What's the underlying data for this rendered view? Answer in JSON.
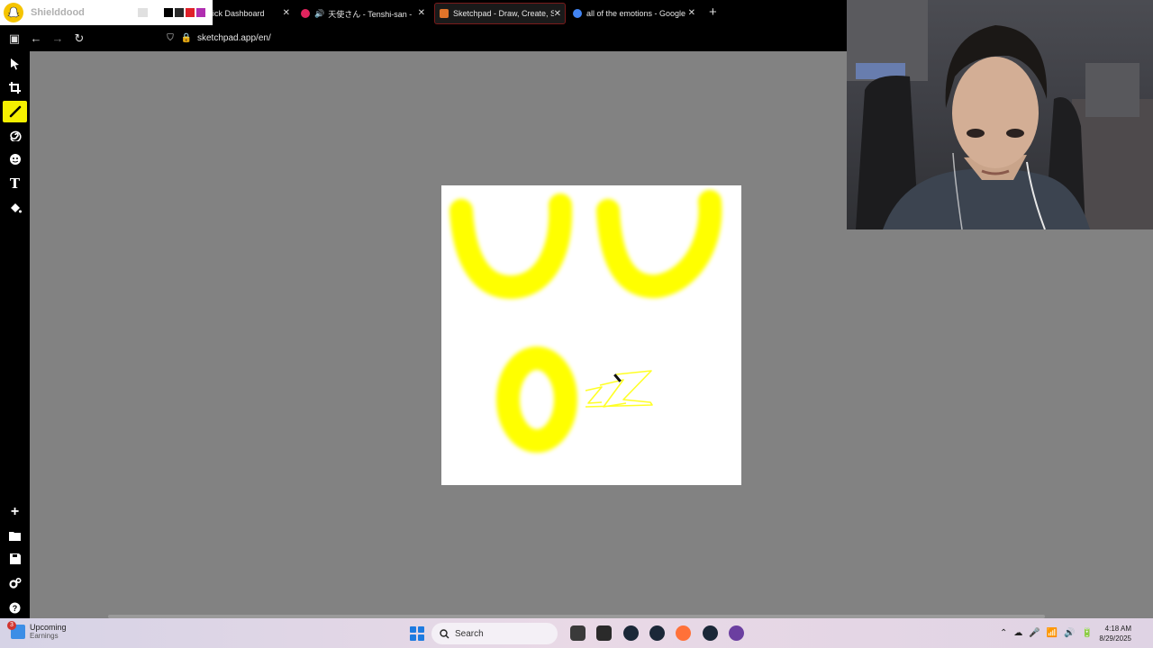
{
  "overlay": {
    "app_name": "Shielddood",
    "swatch_colors": [
      "#000000",
      "#2a2a2a",
      "#e0202a",
      "#b02eb0"
    ]
  },
  "tabs": [
    {
      "title": "ick Dashboard",
      "favicon_color": ""
    },
    {
      "title": "天使さん - Tenshi-san - You",
      "favicon_color": "#e0245e",
      "audio": true
    },
    {
      "title": "Sketchpad - Draw, Create, Shar",
      "favicon_color": "#e0742a",
      "active": true
    },
    {
      "title": "all of the emotions - Google Se",
      "favicon_color": "#4285f4"
    }
  ],
  "nav": {
    "url": "sketchpad.app/en/"
  },
  "toolbar": {
    "tools": [
      "select-icon",
      "crop-icon",
      "brush-icon",
      "spiral-icon",
      "sticker-icon",
      "text-icon",
      "fill-icon"
    ],
    "active_tool": "brush-icon",
    "bottom_tools": [
      "add-icon",
      "folder-icon",
      "save-icon",
      "settings-icon",
      "help-icon"
    ]
  },
  "drawing": {
    "stroke_color": "#ffff00",
    "text_letter": "T"
  },
  "taskbar": {
    "weather_title": "Upcoming",
    "weather_sub": "Earnings",
    "weather_badge": "3",
    "search_placeholder": "Search",
    "time": "4:18 AM",
    "date": "8/29/2025"
  }
}
